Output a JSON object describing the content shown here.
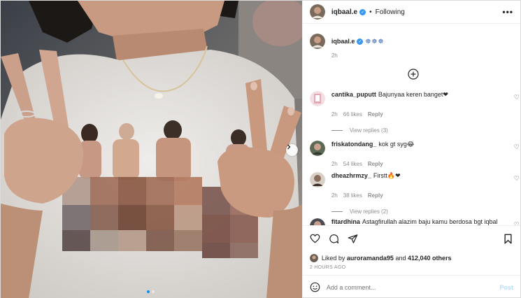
{
  "post": {
    "author": "iqbaal.e",
    "follow_status": "Following",
    "separator": "•",
    "more": "•••",
    "caption_emoji": "☸☸☸",
    "caption_time": "2h"
  },
  "comments": [
    {
      "user": "cantika_puputt",
      "text": "Bajunyaa keren banget❤",
      "time": "2h",
      "likes": "66 likes",
      "reply": "Reply",
      "view_replies": "View replies (3)"
    },
    {
      "user": "friskatondang_",
      "text": "kok gt syg😂",
      "time": "2h",
      "likes": "54 likes",
      "reply": "Reply",
      "view_replies": ""
    },
    {
      "user": "dheazhrmzy_",
      "text": "Firstt🔥❤",
      "time": "2h",
      "likes": "38 likes",
      "reply": "Reply",
      "view_replies": "View replies (2)"
    },
    {
      "user": "fitardhina",
      "text": "Astagfirullah alazim baju kamu berdosa bgt iqbal",
      "time": "",
      "likes": "",
      "reply": "",
      "view_replies": ""
    }
  ],
  "likes_bar": {
    "prefix": "Liked by",
    "user": "auroramanda95",
    "middle": "and",
    "count": "412,040 others"
  },
  "timestamp": "2 HOURS AGO",
  "add_comment": {
    "placeholder": "Add a comment...",
    "post_label": "Post"
  },
  "carousel": {
    "slides": 2,
    "active": 1
  },
  "colors": {
    "verified": "#3897f0",
    "post_disabled": "#b2dffc",
    "muted": "#8e8e8e"
  }
}
